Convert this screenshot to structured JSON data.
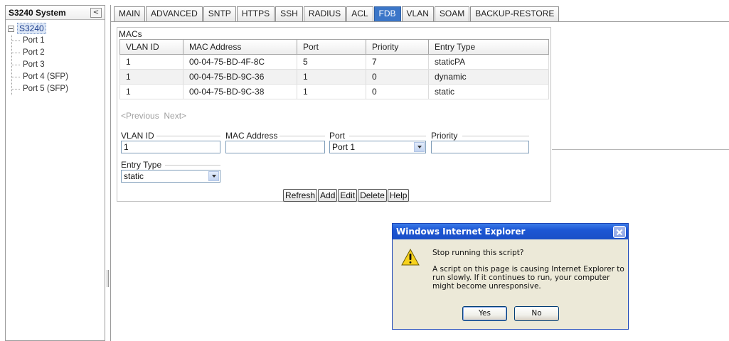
{
  "sidebar": {
    "title": "S3240 System",
    "collapse_glyph": "<",
    "tree": {
      "root": "S3240",
      "items": [
        "Port 1",
        "Port 2",
        "Port 3",
        "Port 4 (SFP)",
        "Port 5 (SFP)"
      ]
    }
  },
  "tabs": [
    "MAIN",
    "ADVANCED",
    "SNTP",
    "HTTPS",
    "SSH",
    "RADIUS",
    "ACL",
    "FDB",
    "VLAN",
    "SOAM",
    "BACKUP-RESTORE"
  ],
  "active_tab": "FDB",
  "macs": {
    "group_title": "MACs",
    "columns": [
      "VLAN ID",
      "MAC Address",
      "Port",
      "Priority",
      "Entry Type"
    ],
    "rows": [
      [
        "1",
        "00-04-75-BD-4F-8C",
        "5",
        "7",
        "staticPA"
      ],
      [
        "1",
        "00-04-75-BD-9C-36",
        "1",
        "0",
        "dynamic"
      ],
      [
        "1",
        "00-04-75-BD-9C-38",
        "1",
        "0",
        "static"
      ]
    ],
    "pager": {
      "previous": "<Previous",
      "next": "Next>"
    }
  },
  "form": {
    "vlan_id": {
      "label": "VLAN ID",
      "value": "1"
    },
    "mac_address": {
      "label": "MAC Address",
      "value": ""
    },
    "port": {
      "label": "Port",
      "value": "Port 1"
    },
    "priority": {
      "label": "Priority",
      "value": ""
    },
    "entry_type": {
      "label": "Entry Type",
      "value": "static"
    }
  },
  "buttons": {
    "refresh": "Refresh",
    "add": "Add",
    "edit": "Edit",
    "delete": "Delete",
    "help": "Help"
  },
  "dialog": {
    "title": "Windows Internet Explorer",
    "question": "Stop running this script?",
    "message": "A script on this page is causing Internet Explorer to run slowly. If it continues to run, your computer might become unresponsive.",
    "yes": "Yes",
    "no": "No",
    "icon": "warning-icon"
  },
  "colors": {
    "active_tab": "#3b76c8",
    "dialog_title": "#1c56d4",
    "dialog_body": "#ece9d8"
  }
}
